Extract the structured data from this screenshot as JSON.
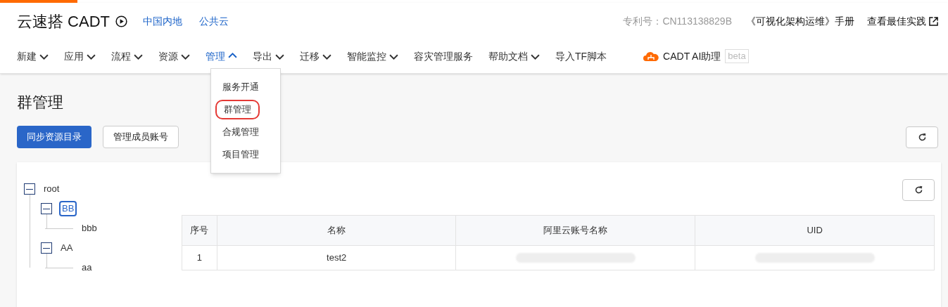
{
  "header": {
    "title": "云速搭 CADT",
    "region": "中国内地",
    "cloud": "公共云",
    "patent": "专利号：CN113138829B",
    "manual": "《可视化架构运维》手册",
    "best_practice": "查看最佳实践"
  },
  "nav": [
    {
      "label": "新建",
      "dropdown": true,
      "expanded": false,
      "selected": false
    },
    {
      "label": "应用",
      "dropdown": true,
      "expanded": false,
      "selected": false
    },
    {
      "label": "流程",
      "dropdown": true,
      "expanded": false,
      "selected": false
    },
    {
      "label": "资源",
      "dropdown": true,
      "expanded": false,
      "selected": false
    },
    {
      "label": "管理",
      "dropdown": true,
      "expanded": true,
      "selected": true
    },
    {
      "label": "导出",
      "dropdown": true,
      "expanded": false,
      "selected": false
    },
    {
      "label": "迁移",
      "dropdown": true,
      "expanded": false,
      "selected": false
    },
    {
      "label": "智能监控",
      "dropdown": true,
      "expanded": false,
      "selected": false
    },
    {
      "label": "容灾管理服务",
      "dropdown": false,
      "selected": false
    },
    {
      "label": "帮助文档",
      "dropdown": true,
      "expanded": false,
      "selected": false
    },
    {
      "label": "导入TF脚本",
      "dropdown": false,
      "selected": false
    }
  ],
  "assistant": {
    "label": "CADT AI助理",
    "badge": "beta"
  },
  "menu": [
    {
      "label": "服务开通",
      "selected": false
    },
    {
      "label": "群管理",
      "selected": true
    },
    {
      "label": "合规管理",
      "selected": false
    },
    {
      "label": "项目管理",
      "selected": false
    }
  ],
  "page_title": "群管理",
  "buttons": [
    {
      "label": "同步资源目录",
      "kind": "primary"
    },
    {
      "label": "管理成员账号",
      "kind": "default"
    }
  ],
  "tree": [
    {
      "label": "root",
      "expanded": true,
      "selected": false,
      "children": [
        {
          "label": "BB",
          "expanded": true,
          "selected": true,
          "children": [
            {
              "label": "bbb",
              "selected": false
            }
          ]
        },
        {
          "label": "AA",
          "expanded": true,
          "selected": false,
          "children": [
            {
              "label": "aa",
              "selected": false
            }
          ]
        }
      ]
    }
  ],
  "table": {
    "columns": [
      "序号",
      "名称",
      "阿里云账号名称",
      "UID"
    ],
    "rows": [
      [
        {
          "kind": "text",
          "text": "1"
        },
        {
          "kind": "text",
          "text": "test2"
        },
        {
          "kind": "masked"
        },
        {
          "kind": "masked"
        }
      ]
    ]
  }
}
